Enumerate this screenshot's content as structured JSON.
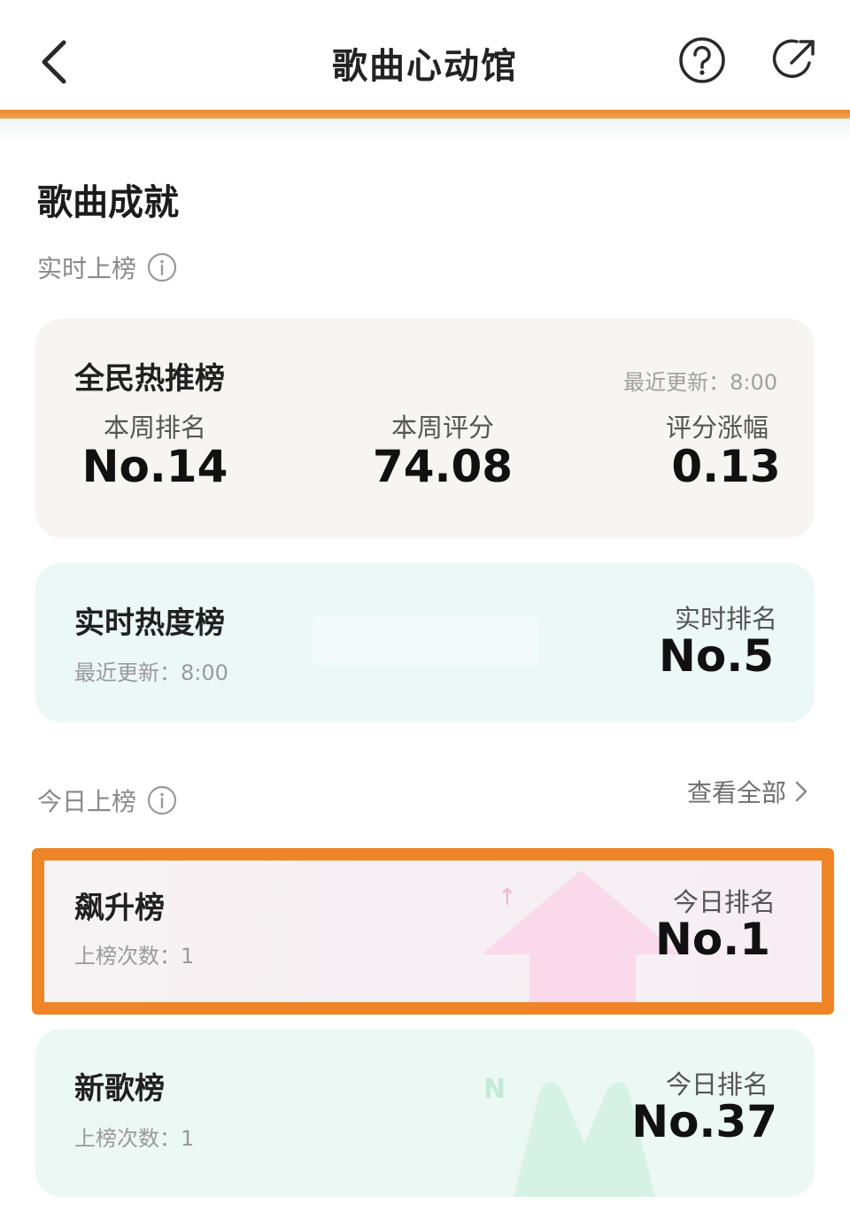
{
  "header": {
    "title": "歌曲心动馆",
    "back_icon": "chevron-left-icon",
    "help_icon": "question-circle-icon",
    "share_icon": "share-arrow-icon",
    "accent": "#ef8526"
  },
  "achievements": {
    "title": "歌曲成就",
    "realtime_label": "实时上榜",
    "today_label": "今日上榜",
    "view_all": "查看全部"
  },
  "realtime_charts": [
    {
      "name": "全民热推榜",
      "updated": "最近更新：8:00",
      "metrics": [
        {
          "label": "本周排名",
          "value": "No.14"
        },
        {
          "label": "本周评分",
          "value": "74.08"
        },
        {
          "label": "评分涨幅",
          "value": "0.13"
        }
      ]
    },
    {
      "name": "实时热度榜",
      "updated": "最近更新：8:00",
      "rank_label": "实时排名",
      "rank": "No.5"
    }
  ],
  "today_charts": [
    {
      "name": "飙升榜",
      "count": "上榜次数：1",
      "rank_label": "今日排名",
      "rank": "No.1",
      "highlighted": true
    },
    {
      "name": "新歌榜",
      "count": "上榜次数：1",
      "rank_label": "今日排名",
      "rank": "No.37"
    }
  ]
}
